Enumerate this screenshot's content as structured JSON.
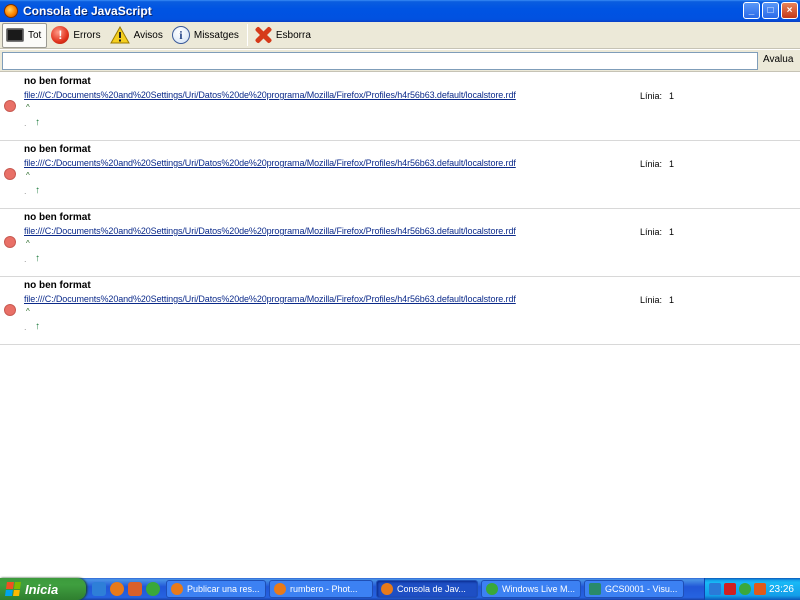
{
  "window": {
    "title": "Consola de JavaScript",
    "controls": {
      "minimize": "_",
      "maximize": "□",
      "close": "×"
    }
  },
  "toolbar": {
    "items": [
      {
        "label": "Tot",
        "icon": "console-icon",
        "active": true
      },
      {
        "label": "Errors",
        "icon": "error-icon",
        "active": false
      },
      {
        "label": "Avisos",
        "icon": "warning-icon",
        "active": false
      },
      {
        "label": "Missatges",
        "icon": "info-icon",
        "active": false
      }
    ],
    "clear": {
      "label": "Esborra",
      "icon": "clear-x-icon"
    }
  },
  "eval": {
    "value": "",
    "button_label": "Avalua"
  },
  "messages": [
    {
      "title": "no ben format",
      "file": "file:///C:/Documents%20and%20Settings/Uri/Datos%20de%20programa/Mozilla/Firefox/Profiles/h4r56b63.default/localstore.rdf",
      "line_label": "Línia:",
      "line": "1",
      "caret": "^",
      "source": "."
    },
    {
      "title": "no ben format",
      "file": "file:///C:/Documents%20and%20Settings/Uri/Datos%20de%20programa/Mozilla/Firefox/Profiles/h4r56b63.default/localstore.rdf",
      "line_label": "Línia:",
      "line": "1",
      "caret": "^",
      "source": "."
    },
    {
      "title": "no ben format",
      "file": "file:///C:/Documents%20and%20Settings/Uri/Datos%20de%20programa/Mozilla/Firefox/Profiles/h4r56b63.default/localstore.rdf",
      "line_label": "Línia:",
      "line": "1",
      "caret": "^",
      "source": "."
    },
    {
      "title": "no ben format",
      "file": "file:///C:/Documents%20and%20Settings/Uri/Datos%20de%20programa/Mozilla/Firefox/Profiles/h4r56b63.default/localstore.rdf",
      "line_label": "Línia:",
      "line": "1",
      "caret": "^",
      "source": "."
    }
  ],
  "taskbar": {
    "start_label": "Inicia",
    "tasks": [
      {
        "label": "Publicar una res...",
        "icon": "firefox-icon",
        "active": false
      },
      {
        "label": "rumbero - Phot...",
        "icon": "firefox-icon",
        "active": false
      },
      {
        "label": "Consola de Jav...",
        "icon": "firefox-icon",
        "active": true
      },
      {
        "label": "Windows Live M...",
        "icon": "messenger-icon",
        "active": false
      },
      {
        "label": "GCS0001 - Visu...",
        "icon": "image-viewer-icon",
        "active": false
      }
    ],
    "clock": "23:26"
  },
  "colors": {
    "error_dot": "#e97067",
    "link": "#0b2a8a",
    "titlebar": "#0054e3",
    "start_green": "#3c9a3c"
  }
}
